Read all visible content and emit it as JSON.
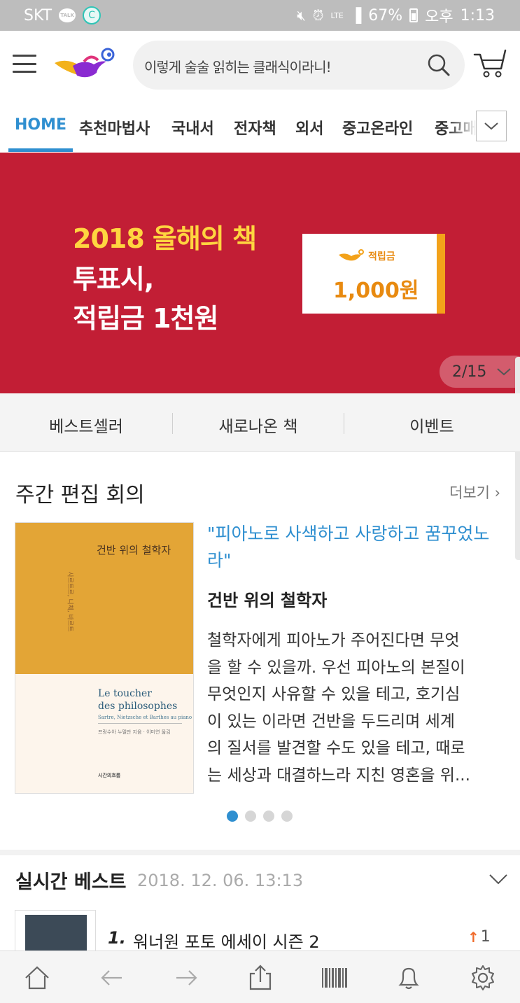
{
  "status_bar": {
    "carrier": "SKT",
    "talk_badge": "TALK",
    "c_badge": "C",
    "lte": "LTE",
    "battery": "67%",
    "ampm": "오후",
    "time": "1:13"
  },
  "header": {
    "search_query": "이렇게 술술 읽히는 클래식이라니!",
    "icons": [
      "menu-icon",
      "lamp-logo",
      "search-icon",
      "cart-icon"
    ]
  },
  "nav": {
    "tabs": [
      "HOME",
      "추천마법사",
      "국내서",
      "전자책",
      "외서",
      "중고온라인",
      "중고매"
    ],
    "active_index": 0
  },
  "banner": {
    "line1": "2018 올해의 책",
    "line2": "투표시,",
    "line3": "적립금 1천원",
    "coupon_label": "적립금",
    "coupon_amount": "1,000원",
    "pager": "2/15",
    "colors": {
      "background": "#c21e35",
      "highlight": "#ffd540",
      "coupon_accent": "#f3a21a"
    }
  },
  "quick_tabs": [
    "베스트셀러",
    "새로나온 책",
    "이벤트"
  ],
  "weekly": {
    "title": "주간 편집 회의",
    "more": "더보기",
    "cover": {
      "title_ko": "건반 위의 철학자",
      "vertical_text": "사르트르, 니체, 바르트",
      "title_en_1": "Le toucher",
      "title_en_2": "des philosophes",
      "subtitle_en": "Sartre, Nietzsche et Barthes au piano",
      "credit": "프랑수아 누델만 지음 · 이미연 옮김",
      "publisher": "시간의흐름"
    },
    "quote": "\"피아노로 사색하고 사랑하고 꿈꾸었노라\"",
    "book_title": "건반 위의 철학자",
    "description_lines": [
      "철학자에게 피아노가 주어진다면 무엇",
      "을 할 수 있을까. 우선 피아노의 본질이",
      "무엇인지 사유할 수 있을 테고, 호기심",
      "이 있는 이라면 건반을 두드리며 세계",
      "의 질서를 발견할 수도 있을 테고, 때로",
      "는 세상과 대결하느라 지친 영혼을 위..."
    ],
    "carousel": {
      "count": 4,
      "active_index": 0
    }
  },
  "realtime_best": {
    "title": "실시간 베스트",
    "timestamp": "2018. 12. 06. 13:13",
    "items": [
      {
        "rank": "1.",
        "title": "워너원 포토 에세이 시즌 2",
        "change": "1",
        "direction": "up"
      }
    ]
  },
  "bottom_bar": {
    "buttons": [
      "home-icon",
      "back-icon",
      "forward-icon",
      "share-icon",
      "barcode-icon",
      "bell-icon",
      "settings-icon"
    ]
  }
}
